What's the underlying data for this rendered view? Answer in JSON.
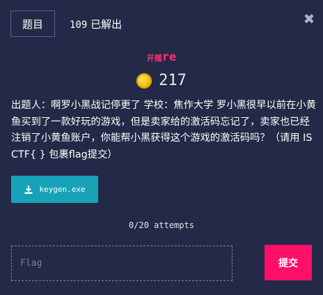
{
  "header": {
    "tab_label": "题目",
    "solves_count": "109",
    "solves_label": "已解出"
  },
  "category": {
    "prefix": "开摆",
    "name": "re"
  },
  "points": {
    "value": "217",
    "icon": "coin-icon"
  },
  "description": "出题人：啊罗小黑战记停更了 学校：焦作大学 罗小黑很早以前在小黄鱼买到了一款好玩的游戏，但是卖家给的激活码忘记了，卖家也已经注销了小黄鱼账户，你能帮小黑获得这个游戏的激活码吗？（请用 ISCTF{ } 包裹flag提交）",
  "download": {
    "label": "keygen.exe",
    "icon": "download-icon"
  },
  "attempts": "0/20 attempts",
  "flag_input": {
    "placeholder": "Flag",
    "value": ""
  },
  "submit_label": "提交",
  "colors": {
    "background": "#232946",
    "accent": "#ff0f6a",
    "download": "#17a2b8",
    "category": "#ff2d78"
  }
}
